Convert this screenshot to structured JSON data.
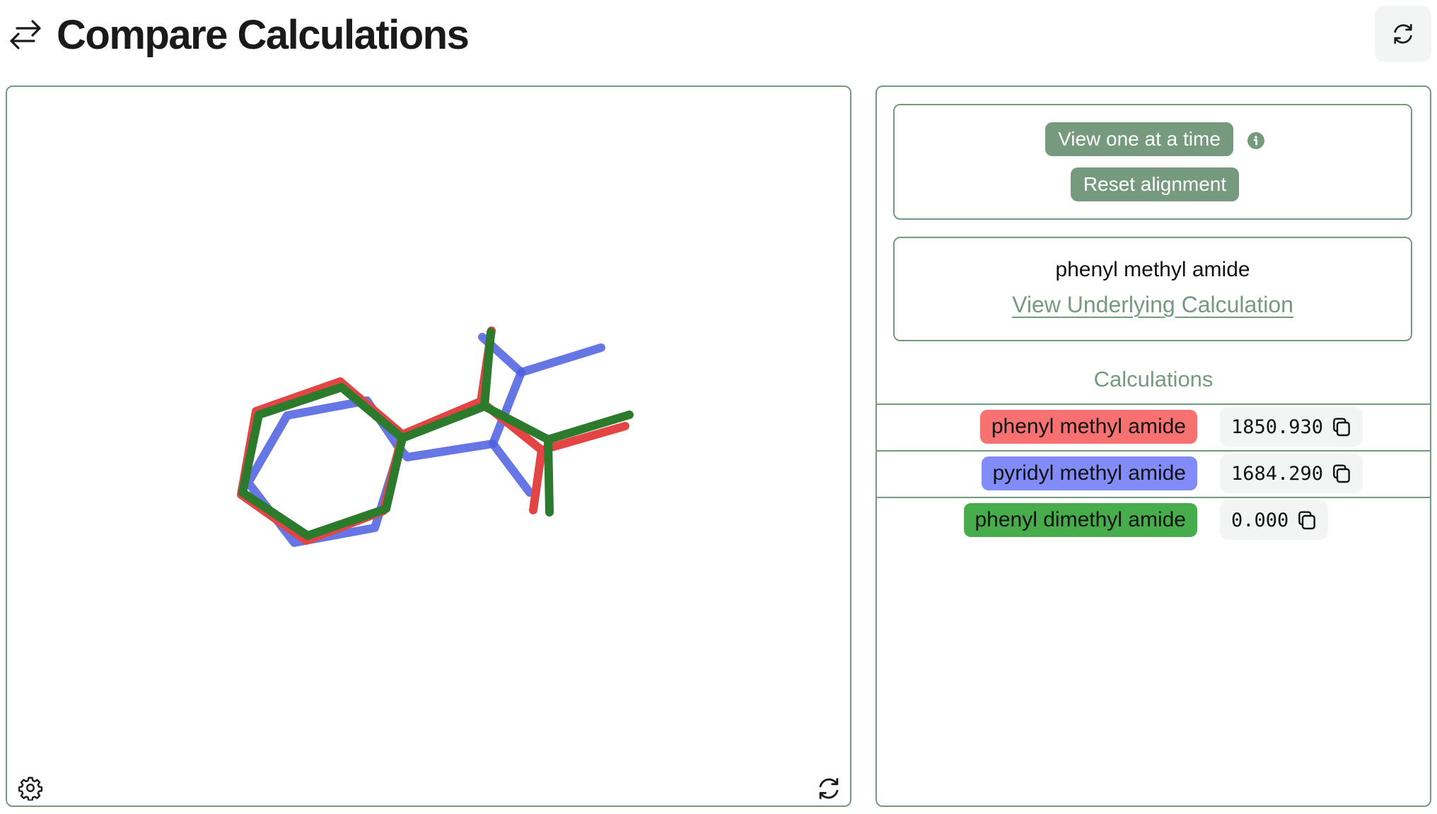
{
  "header": {
    "icon": "arrows-left-right-icon",
    "title": "Compare Calculations",
    "refresh_icon": "refresh-icon"
  },
  "viewer": {
    "settings_icon": "gear-icon",
    "reset_view_icon": "refresh-icon",
    "molecules": [
      {
        "name": "phenyl methyl amide",
        "color": "#e34545"
      },
      {
        "name": "pyridyl methyl amide",
        "color": "#4b5fe0"
      },
      {
        "name": "phenyl dimethyl amide",
        "color": "#2c7a2c"
      }
    ]
  },
  "controls": {
    "view_one_label": "View one at a time",
    "info_icon": "info-icon",
    "reset_alignment_label": "Reset alignment"
  },
  "selected": {
    "name": "phenyl methyl amide",
    "link_label": "View Underlying Calculation"
  },
  "calculations": {
    "header": "Calculations",
    "rows": [
      {
        "name": "phenyl methyl amide",
        "value": "1850.930",
        "color": "#f87171"
      },
      {
        "name": "pyridyl methyl amide",
        "value": "1684.290",
        "color": "#818cf8"
      },
      {
        "name": "phenyl dimethyl amide",
        "value": "0.000",
        "color": "#46ad4a"
      }
    ]
  },
  "colors": {
    "accent": "#759a7e",
    "value_bg": "#f3f4f4"
  }
}
